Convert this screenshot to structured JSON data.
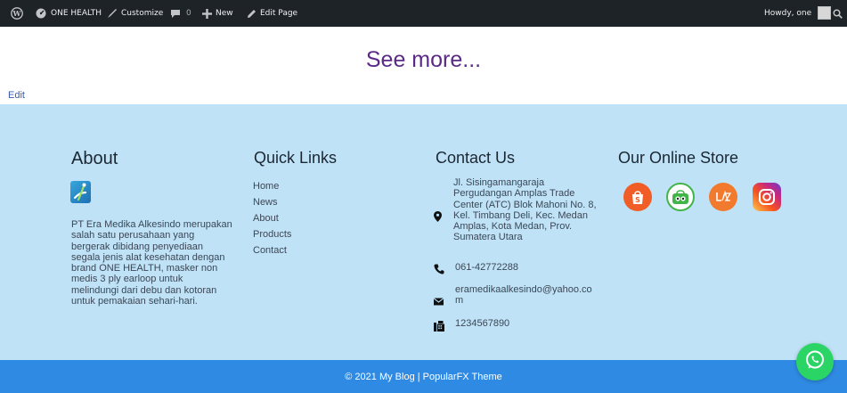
{
  "admin_bar": {
    "site_name": "ONE HEALTH",
    "customize": "Customize",
    "comments_count": "0",
    "new_label": "New",
    "edit_page": "Edit Page",
    "howdy": "Howdy, one"
  },
  "content": {
    "see_more": "See more...",
    "edit": "Edit"
  },
  "footer": {
    "about": {
      "title": "About",
      "lines": [
        "PT Era Medika Alkesindo merupakan",
        "salah satu perusahaan yang",
        "bergerak dibidang penyediaan",
        "segala jenis alat kesehatan dengan",
        "brand ONE HEALTH, masker non",
        "medis 3 ply earloop untuk",
        "melindungi dari debu dan kotoran",
        "untuk pemakaian sehari-hari."
      ]
    },
    "quick_links": {
      "title": "Quick Links",
      "items": [
        "Home",
        "News",
        "About",
        "Products",
        "Contact"
      ]
    },
    "contact": {
      "title": "Contact Us",
      "address_lines": [
        "Jl. Sisingamangaraja",
        "Pergudangan Amplas Trade",
        "Center (ATC) Blok Mahoni No. 8,",
        "Kel. Timbang Deli, Kec. Medan",
        "Amplas, Kota Medan, Prov.",
        "Sumatera Utara"
      ],
      "phone": "061-42772288",
      "email_lines": [
        "eramedikaalkesindo@yahoo.co",
        "m"
      ],
      "fax": "1234567890"
    },
    "online_store": {
      "title": "Our Online Store",
      "stores": [
        {
          "name": "Shopee",
          "color": "#f05d26"
        },
        {
          "name": "Tokopedia",
          "color": "#42b549"
        },
        {
          "name": "Lazada",
          "color": "#f27a2e"
        },
        {
          "name": "Instagram",
          "color": "#c13584"
        }
      ]
    },
    "copyright": "© 2021 My Blog | PopularFX Theme"
  },
  "colors": {
    "admin_bar": "#1d2327",
    "see_more": "#5b2a86",
    "footer_bg": "#bfe2f6",
    "footer_bar": "#2f8ae3",
    "whatsapp": "#2bd565"
  }
}
